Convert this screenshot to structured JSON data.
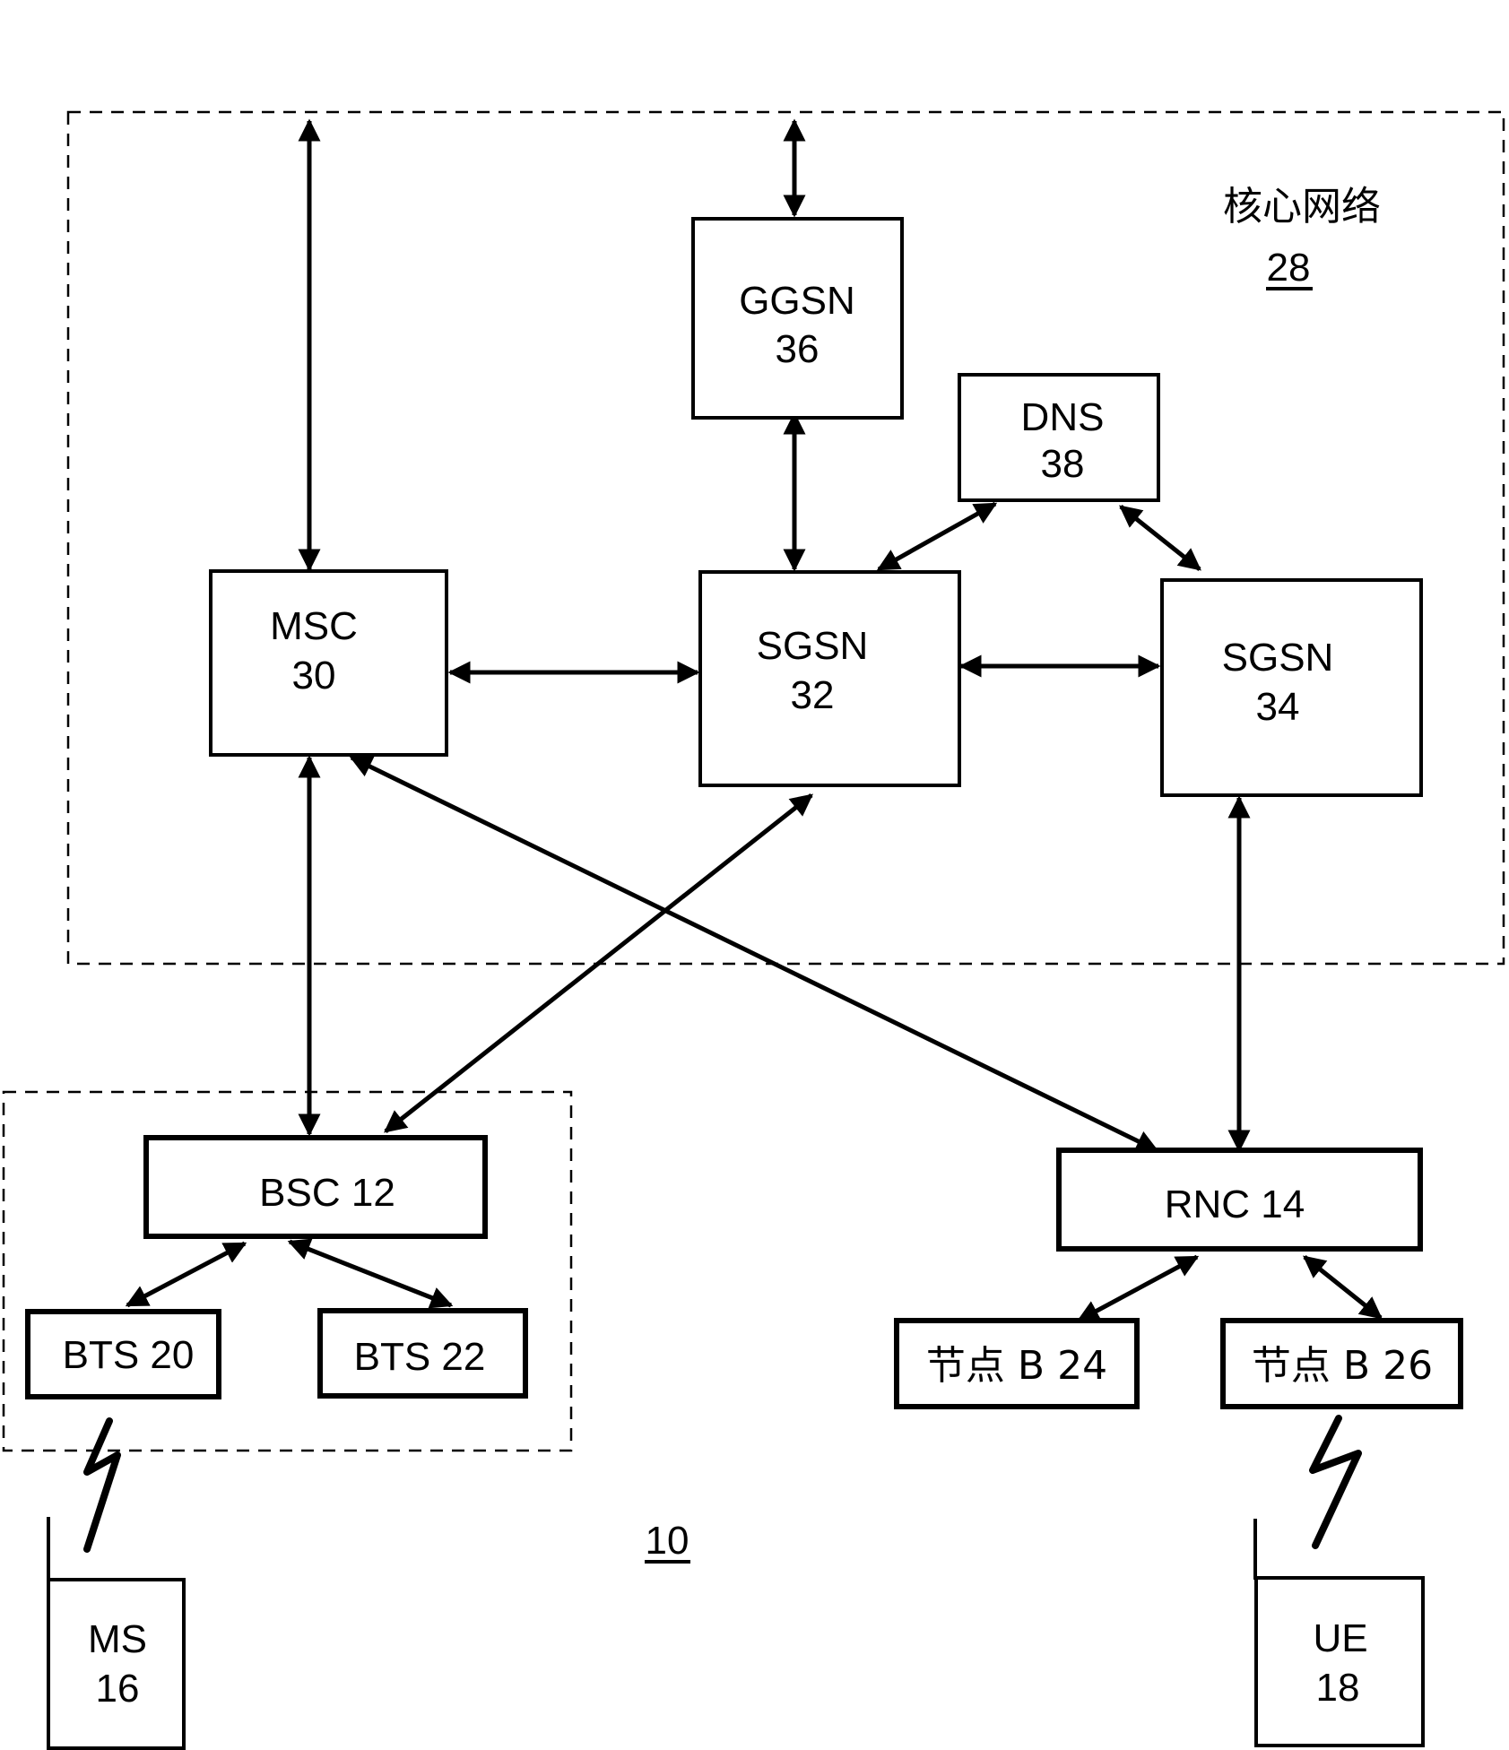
{
  "diagram": {
    "system_ref": "10",
    "core_network": {
      "title": "核心网络",
      "ref": "28"
    },
    "nodes": {
      "ggsn": {
        "line1": "GGSN",
        "line2": "36"
      },
      "dns": {
        "line1": "DNS",
        "line2": "38"
      },
      "msc": {
        "line1": "MSC",
        "line2": "30"
      },
      "sgsn32": {
        "line1": "SGSN",
        "line2": "32"
      },
      "sgsn34": {
        "line1": "SGSN",
        "line2": "34"
      },
      "bsc": {
        "label": "BSC 12"
      },
      "rnc": {
        "label": "RNC 14"
      },
      "bts20": {
        "label": "BTS 20"
      },
      "bts22": {
        "label": "BTS 22"
      },
      "nodeb24": {
        "label": "节点 B 24"
      },
      "nodeb26": {
        "label": "节点 B 26"
      },
      "ms": {
        "line1": "MS",
        "line2": "16"
      },
      "ue": {
        "line1": "UE",
        "line2": "18"
      }
    },
    "connections": [
      {
        "from": "external",
        "to": "msc",
        "type": "bidirectional"
      },
      {
        "from": "external",
        "to": "ggsn",
        "type": "bidirectional"
      },
      {
        "from": "ggsn",
        "to": "sgsn32",
        "type": "bidirectional"
      },
      {
        "from": "dns",
        "to": "sgsn32",
        "type": "bidirectional"
      },
      {
        "from": "dns",
        "to": "sgsn34",
        "type": "bidirectional"
      },
      {
        "from": "msc",
        "to": "sgsn32",
        "type": "bidirectional"
      },
      {
        "from": "sgsn32",
        "to": "sgsn34",
        "type": "bidirectional"
      },
      {
        "from": "msc",
        "to": "bsc",
        "type": "bidirectional"
      },
      {
        "from": "msc",
        "to": "rnc",
        "type": "bidirectional"
      },
      {
        "from": "sgsn32",
        "to": "bsc",
        "type": "bidirectional"
      },
      {
        "from": "sgsn34",
        "to": "rnc",
        "type": "bidirectional"
      },
      {
        "from": "bsc",
        "to": "bts20",
        "type": "bidirectional"
      },
      {
        "from": "bsc",
        "to": "bts22",
        "type": "bidirectional"
      },
      {
        "from": "rnc",
        "to": "nodeb24",
        "type": "bidirectional"
      },
      {
        "from": "rnc",
        "to": "nodeb26",
        "type": "bidirectional"
      },
      {
        "from": "bts20",
        "to": "ms",
        "type": "wireless"
      },
      {
        "from": "nodeb26",
        "to": "ue",
        "type": "wireless"
      }
    ]
  }
}
